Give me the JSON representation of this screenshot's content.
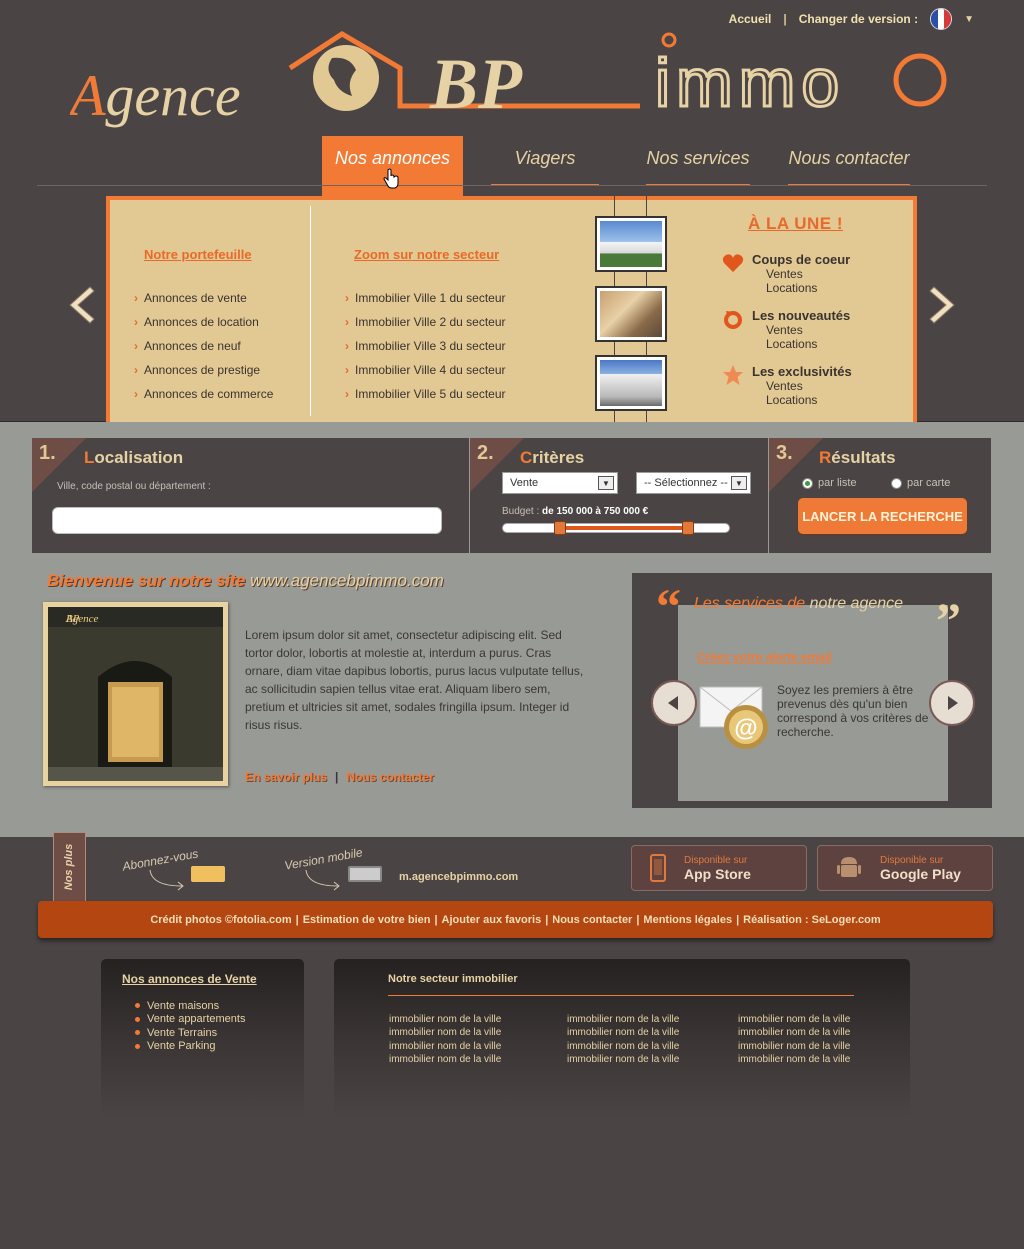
{
  "header": {
    "home_link": "Accueil",
    "separator": "|",
    "version_label": "Changer de version :",
    "flag_icon": "flag-fr-icon"
  },
  "logo": {
    "word1": "Agence",
    "word2": "BP",
    "word3": "immo"
  },
  "nav": {
    "items": [
      {
        "label": "Nos annonces"
      },
      {
        "label": "Viagers"
      },
      {
        "label": "Nos services"
      },
      {
        "label": "Nous contacter"
      }
    ]
  },
  "mega": {
    "portfolio_title": "Notre portefeuille",
    "portfolio_items": [
      "Annonces de vente",
      "Annonces de location",
      "Annonces de neuf",
      "Annonces de prestige",
      "Annonces de commerce"
    ],
    "zoom_title": "Zoom sur notre secteur",
    "zoom_items": [
      "Immobilier Ville 1 du secteur",
      "Immobilier Ville 2 du secteur",
      "Immobilier Ville 3 du secteur",
      "Immobilier Ville 4 du secteur",
      "Immobilier Ville 5 du secteur"
    ],
    "une_title": "À LA UNE !",
    "une_items": [
      {
        "title": "Coups de coeur",
        "sub1": "Ventes",
        "sub2": "Locations"
      },
      {
        "title": "Les nouveautés",
        "sub1": "Ventes",
        "sub2": "Locations"
      },
      {
        "title": "Les exclusivités",
        "sub1": "Ventes",
        "sub2": "Locations"
      }
    ]
  },
  "search": {
    "step1": {
      "num": "1.",
      "first": "L",
      "rest": "ocalisation",
      "label": "Ville, code postal ou département :",
      "value": ""
    },
    "step2": {
      "num": "2.",
      "first": "C",
      "rest": "ritères",
      "select1": "Vente",
      "select2": "-- Sélectionnez --",
      "budget_label": "Budget",
      "budget_sep": ":",
      "budget_value": "de 150 000 à 750 000 €",
      "range_low": 0.25,
      "range_high": 0.82
    },
    "step3": {
      "num": "3.",
      "first": "R",
      "rest": "ésultats",
      "radio1": "par liste",
      "radio2": "par carte",
      "button": "LANCER LA RECHERCHE"
    }
  },
  "welcome": {
    "title_prefix": "Bienvenue sur notre site",
    "title_url": "www.agencebpimmo.com",
    "photo_sign": "Agence",
    "photo_sign2": "BP",
    "text": "Lorem ipsum dolor sit amet, consectetur adipiscing elit. Sed tortor dolor, lobortis at molestie at, interdum a purus. Cras ornare, diam vitae dapibus lobortis, purus lacus vulputate tellus, ac sollicitudin sapien tellus vitae erat. Aliquam libero sem, pretium et ultricies sit amet, sodales fringilla ipsum. Integer id risus risus.",
    "link1": "En savoir plus",
    "separator": "|",
    "link2": "Nous contacter"
  },
  "services": {
    "title_part1": "Les services de",
    "title_part2": "notre agence",
    "alert_link": "Créez votre alerte email",
    "description": "Soyez les premiers à être prevenus dès qu'un bien correspond à vos critères de recherche."
  },
  "footer": {
    "nos_plus": "Nos plus",
    "subscribe": "Abonnez-vous",
    "mobile_label": "Version mobile",
    "mobile_url": "m.agencebpimmo.com",
    "appstore_small": "Disponible sur",
    "appstore_big": "App Store",
    "play_small": "Disponible sur",
    "play_big": "Google Play",
    "credits": [
      "Crédit photos ©fotolia.com",
      "Estimation de votre bien",
      "Ajouter aux favoris",
      "Nous contacter",
      "Mentions légales",
      "Réalisation : SeLoger.com"
    ],
    "credits_sep": "|"
  },
  "bottom": {
    "left_title": "Nos annonces de Vente",
    "left_items": [
      "Vente maisons",
      "Vente appartements",
      "Vente Terrains",
      "Vente Parking"
    ],
    "right_title": "Notre secteur immobilier",
    "right_cols": [
      [
        "immobilier nom de la ville",
        "immobilier nom de la ville",
        "immobilier nom de la ville",
        "immobilier nom de la ville"
      ],
      [
        "immobilier nom de la ville",
        "immobilier nom de la ville",
        "immobilier nom de la ville",
        "immobilier nom de la ville"
      ],
      [
        "immobilier nom de la ville",
        "immobilier nom de la ville",
        "immobilier nom de la ville",
        "immobilier nom de la ville"
      ]
    ]
  },
  "colors": {
    "orange": "#f27a35",
    "beige": "#e2c893",
    "dark": "#4a4544",
    "grey": "#989a96"
  }
}
